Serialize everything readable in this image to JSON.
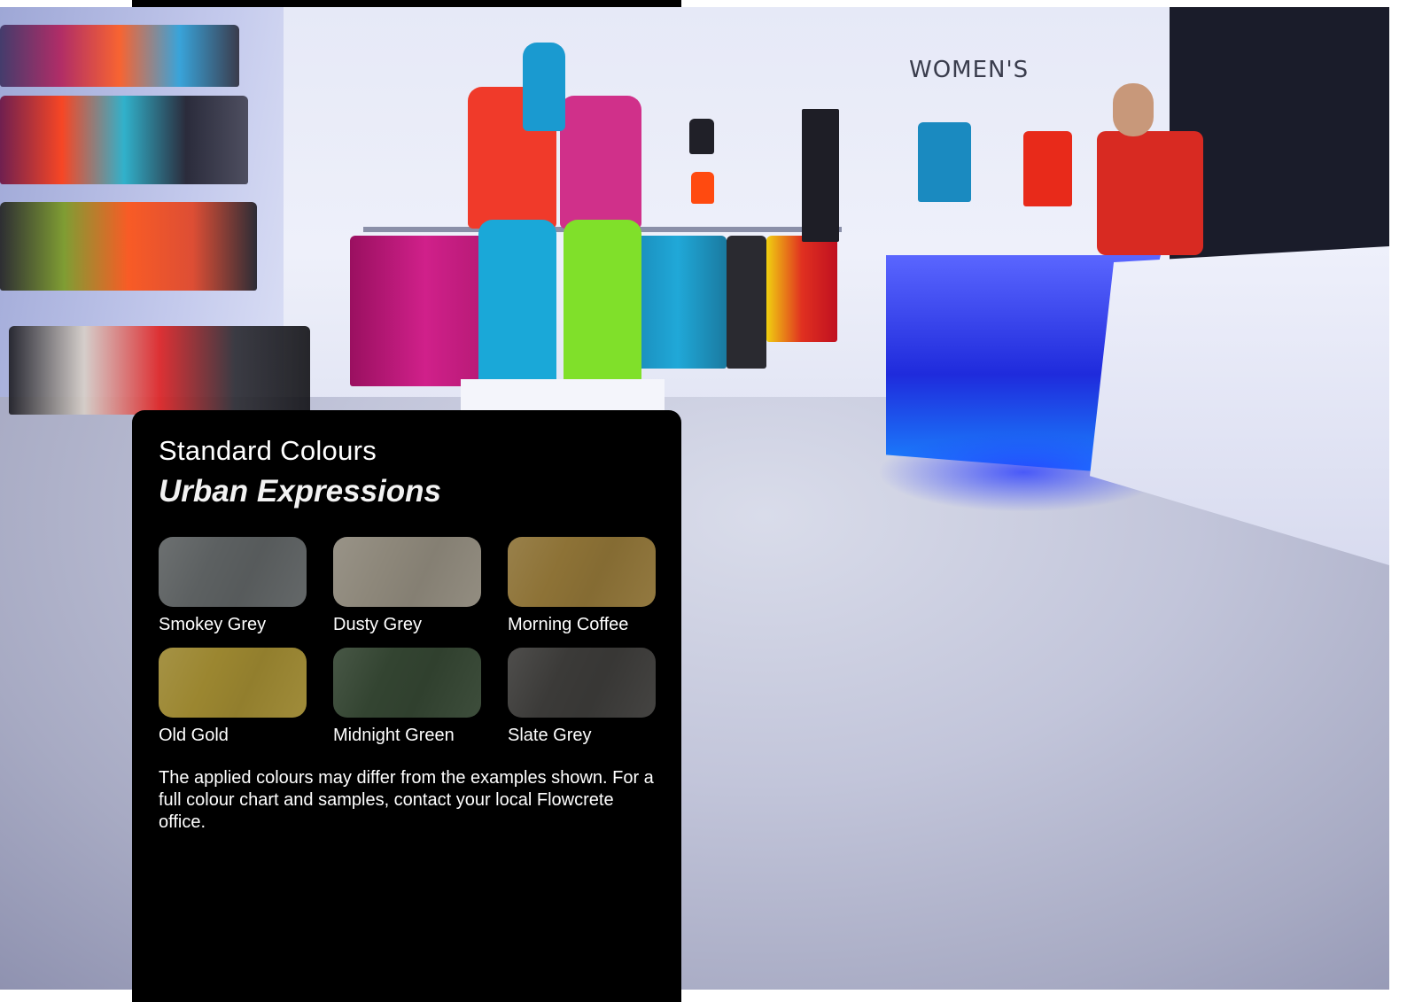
{
  "page": {
    "photo_sign": "WOMEN'S"
  },
  "panel": {
    "title": "Standard Colours",
    "subtitle": "Urban Expressions",
    "swatches": [
      {
        "name": "Smokey Grey",
        "color": "#5c6061"
      },
      {
        "name": "Dusty Grey",
        "color": "#8d877a"
      },
      {
        "name": "Morning Coffee",
        "color": "#8d7236"
      },
      {
        "name": "Old Gold",
        "color": "#9b8630"
      },
      {
        "name": "Midnight Green",
        "color": "#334431"
      },
      {
        "name": "Slate Grey",
        "color": "#3b3a38"
      }
    ],
    "disclaimer": "The applied colours may differ from the examples shown. For a full colour chart and samples, contact your local Flowcrete office."
  }
}
